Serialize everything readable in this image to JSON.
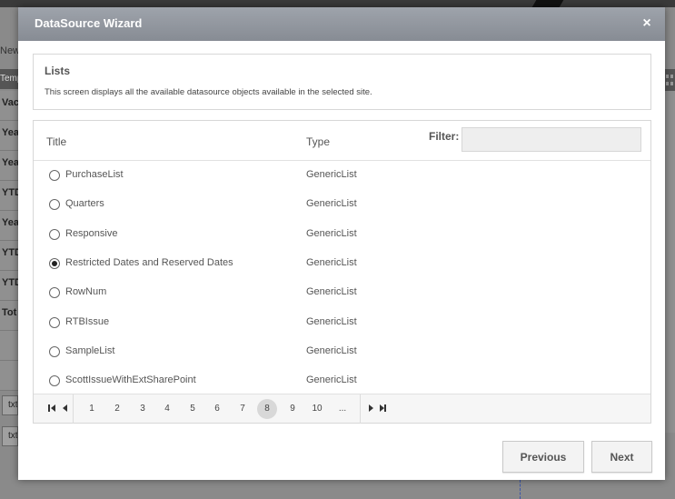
{
  "background": {
    "tab_label": "New",
    "header_label": "Temp",
    "rows": [
      "Vac",
      "Yea",
      "Yea",
      "YTD",
      "Yea",
      "YTD",
      "YTD",
      "Tot",
      "",
      ""
    ],
    "inputs": [
      "txt",
      "txt"
    ]
  },
  "modal": {
    "title": "DataSource Wizard",
    "close_glyph": "×"
  },
  "info": {
    "title": "Lists",
    "description": "This screen displays all the available datasource objects available in the selected site."
  },
  "list": {
    "columns": {
      "title": "Title",
      "type": "Type"
    },
    "filter": {
      "label": "Filter:",
      "value": "",
      "placeholder": ""
    },
    "items": [
      {
        "title": "PurchaseList",
        "type": "GenericList",
        "selected": false
      },
      {
        "title": "Quarters",
        "type": "GenericList",
        "selected": false
      },
      {
        "title": "Responsive",
        "type": "GenericList",
        "selected": false
      },
      {
        "title": "Restricted Dates and Reserved Dates",
        "type": "GenericList",
        "selected": true
      },
      {
        "title": "RowNum",
        "type": "GenericList",
        "selected": false
      },
      {
        "title": "RTBIssue",
        "type": "GenericList",
        "selected": false
      },
      {
        "title": "SampleList",
        "type": "GenericList",
        "selected": false
      },
      {
        "title": "ScottIssueWithExtSharePoint",
        "type": "GenericList",
        "selected": false
      }
    ]
  },
  "pager": {
    "pages": [
      "1",
      "2",
      "3",
      "4",
      "5",
      "6",
      "7",
      "8",
      "9",
      "10",
      "..."
    ],
    "current_page": "8"
  },
  "footer": {
    "previous_label": "Previous",
    "next_label": "Next"
  },
  "colors": {
    "header_gradient_top": "#9ea3ab",
    "header_gradient_bottom": "#878c94",
    "active_page_bg": "#d8d8d8"
  }
}
